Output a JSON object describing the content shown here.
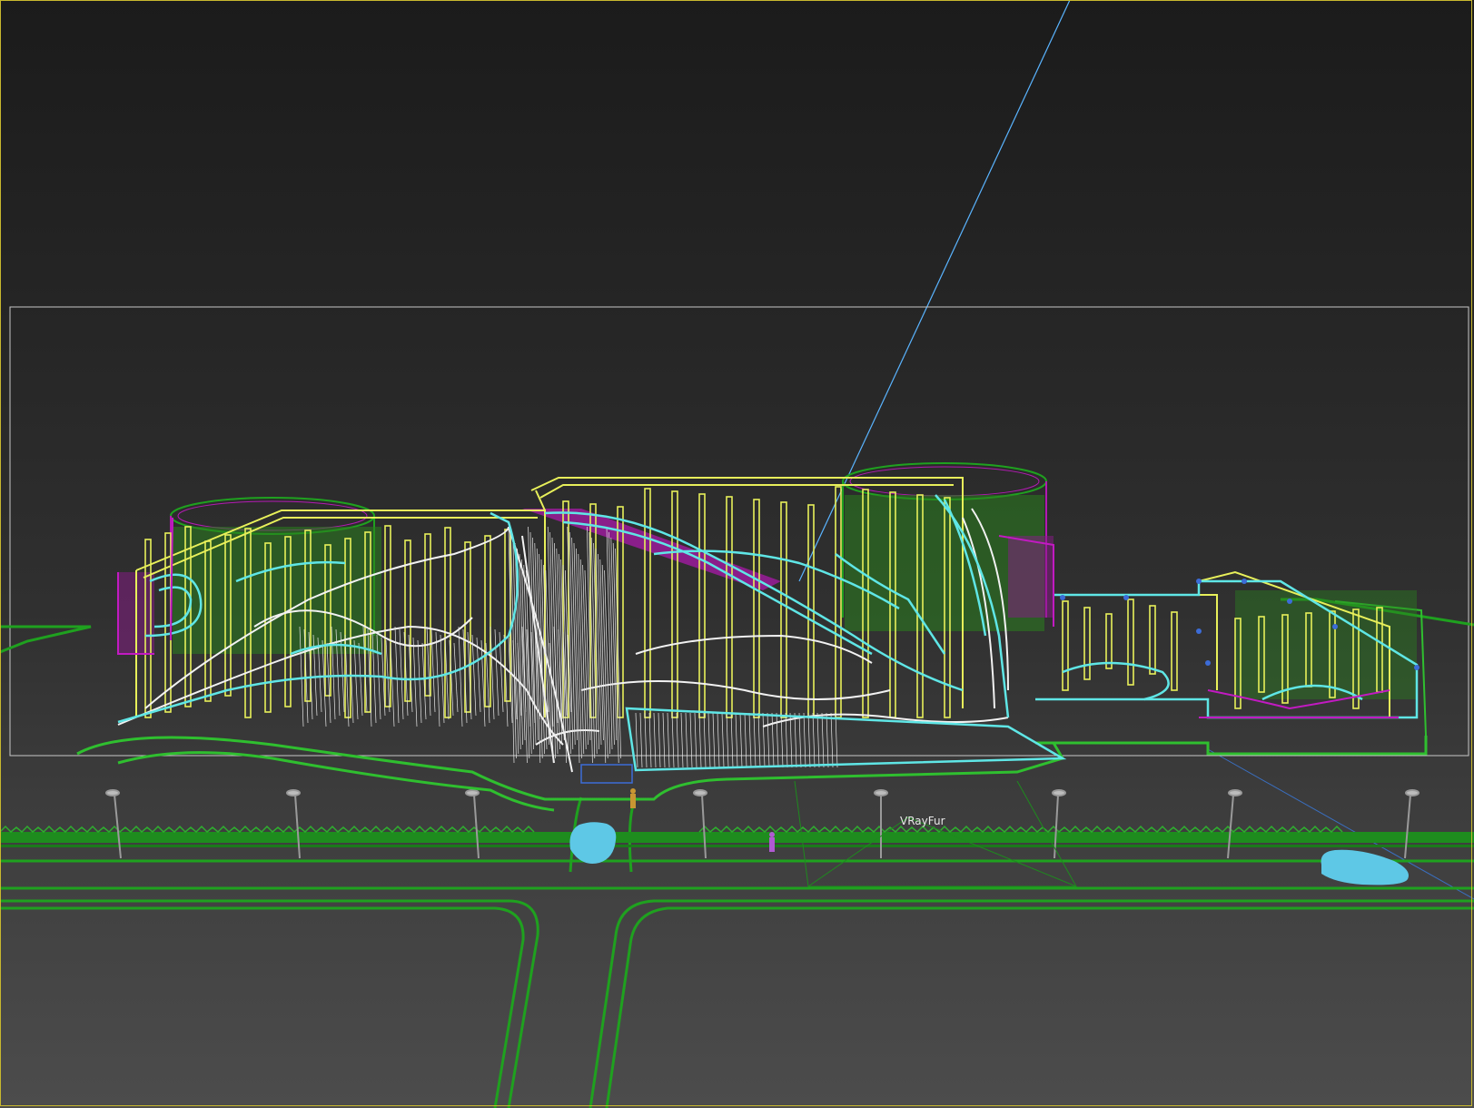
{
  "viewport": {
    "label": "VRayFur",
    "border_color": "#c8b82e"
  },
  "colors": {
    "wire_green": "#1fa11f",
    "wire_bright_green": "#46d846",
    "wire_yellow": "#e8f05a",
    "wire_magenta": "#b21ab2",
    "wire_cyan": "#5fe6e6",
    "wire_white": "#f2f2f2",
    "camera_line": "#5ab4ff",
    "car": "#5ec8e6",
    "person_orange": "#c89632",
    "person_violet": "#b05ad2",
    "selection_box": "#c8c8c8"
  },
  "objects": [
    {
      "name": "building-wireframe"
    },
    {
      "name": "road-network"
    },
    {
      "name": "street-lamps"
    },
    {
      "name": "grass-strip"
    },
    {
      "name": "car-left"
    },
    {
      "name": "car-right"
    },
    {
      "name": "pedestrians"
    }
  ]
}
